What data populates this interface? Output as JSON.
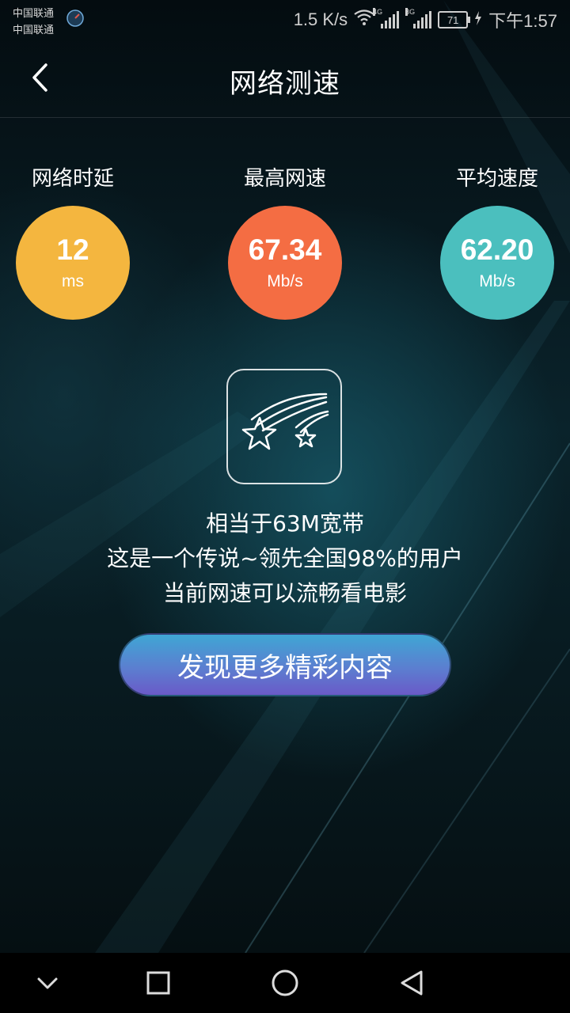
{
  "status_bar": {
    "carrier_1": "中国联通",
    "carrier_2": "中国联通",
    "net_speed": "1.5 K/s",
    "net_4g": "4G",
    "net_3g": "3G",
    "battery": "71",
    "time": "下午1:57"
  },
  "header": {
    "title": "网络测速"
  },
  "metrics": [
    {
      "label": "网络时延",
      "value": "12",
      "unit": "ms",
      "color": "#F4B63F"
    },
    {
      "label": "最高网速",
      "value": "67.34",
      "unit": "Mb/s",
      "color": "#F46D43"
    },
    {
      "label": "平均速度",
      "value": "62.20",
      "unit": "Mb/s",
      "color": "#4BBFBE"
    }
  ],
  "description": {
    "line1": "相当于63M宽带",
    "line2": "这是一个传说~领先全国98%的用户",
    "line3": "当前网速可以流畅看电影"
  },
  "cta": {
    "label": "发现更多精彩内容"
  },
  "icons": {
    "back": "chevron-left-icon",
    "badge": "shooting-stars-icon",
    "nav": [
      "chevron-down-icon",
      "square-icon",
      "circle-icon",
      "triangle-back-icon"
    ]
  }
}
